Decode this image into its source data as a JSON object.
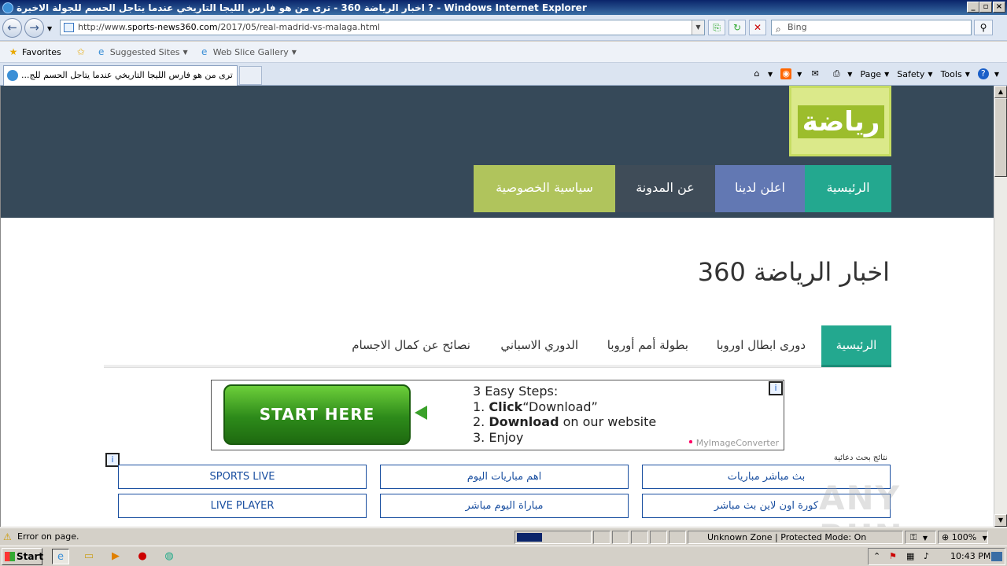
{
  "window": {
    "title": "اخبار الرياضة 360 - ترى من هو فارس الليجا التاريخي عندما يتاجل الحسم للجولة الاخيرة ? - Windows Internet Explorer"
  },
  "address": {
    "url_prefix": "http://www.",
    "url_domain": "sports-news360.com",
    "url_path": "/2017/05/real-madrid-vs-malaga.html"
  },
  "search": {
    "placeholder": "Bing"
  },
  "favorites": {
    "label": "Favorites",
    "suggested": "Suggested Sites",
    "gallery": "Web Slice Gallery"
  },
  "tab": {
    "title": "ترى من هو فارس الليجا التاريخي عندما يتاجل الحسم للج..."
  },
  "commands": {
    "page": "Page",
    "safety": "Safety",
    "tools": "Tools"
  },
  "site": {
    "logo_text": "رياضة",
    "top_nav": [
      {
        "label": "الرئيسية",
        "color": "#23a88f"
      },
      {
        "label": "اعلن لدينا",
        "color": "#6278b3"
      },
      {
        "label": "عن المدونة",
        "color": "#3f4c58"
      },
      {
        "label": "سياسية الخصوصية",
        "color": "#b0c45c"
      }
    ],
    "page_title": "اخبار الرياضة 360",
    "main_nav": [
      "الرئيسية",
      "دورى ابطال اوروبا",
      "بطولة أمم أوروبا",
      "الدوري الاسباني",
      "نصائح عن كمال الاجسام"
    ]
  },
  "ad": {
    "button": "START HERE",
    "heading": "3 Easy Steps:",
    "step1_num": "1.",
    "step1_bold": "Click",
    "step1_rest": "“Download”",
    "step2_num": "2.",
    "step2_bold": "Download",
    "step2_rest": "on our website",
    "step3": "3. Enjoy",
    "brand": "MyImageConverter",
    "info_glyph": "i"
  },
  "ad_links": {
    "label": "نتائج بحث دعائية",
    "items": [
      "SPORTS LIVE",
      "اهم مباريات اليوم",
      "بث مباشر مباريات",
      "LIVE PLAYER",
      "مباراة اليوم مباشر",
      "كورة اون لاين بث مباشر"
    ]
  },
  "watermark": "ANY RUN",
  "statusbar": {
    "message": "Error on page.",
    "zone": "Unknown Zone | Protected Mode: On",
    "zoom": "100%"
  },
  "taskbar": {
    "start": "Start",
    "clock": "10:43 PM"
  }
}
